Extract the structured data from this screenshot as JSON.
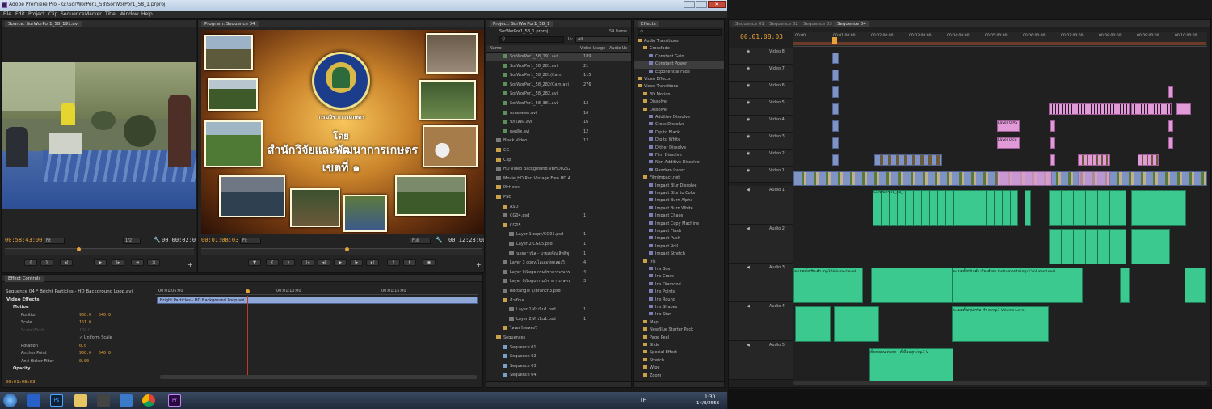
{
  "app": {
    "title": "Adobe Premiere Pro - G:\\SorWorPor1_58\\SorWorPor1_58_1.prproj",
    "menu": [
      "File",
      "Edit",
      "Project",
      "Clip",
      "Sequence",
      "Marker",
      "Title",
      "Window",
      "Help"
    ]
  },
  "source_monitor": {
    "tab": "Source: SorWorPor1_58_191.avi",
    "timecode_in": "00;58;43:00",
    "fit": "Fit",
    "timecode_out": "00:00:02:09",
    "zoom": "1/2"
  },
  "program_monitor": {
    "tab": "Program: Sequence 04",
    "timecode_in": "00:01:08:03",
    "fit": "Fit",
    "full": "Full",
    "timecode_out": "00:12:28:00",
    "title_line1": "โดย",
    "title_line2": "สำนักวิจัยและพัฒนาการเกษตร",
    "title_line3": "เขตที่ ๑",
    "logo_text": "กรมวิชาการเกษตร"
  },
  "effect_controls": {
    "tab": "Effect Controls",
    "clip_label": "Sequence 04 * Bright Particles - HD Background Loop.avi",
    "ruler": [
      "00:01:05:00",
      "00:01:10:00",
      "00:01:15:00"
    ],
    "timeline_clip": "Bright Particles - HD Background Loop.avi",
    "section": "Video Effects",
    "rows": [
      {
        "name": "Motion",
        "v1": "",
        "v2": ""
      },
      {
        "name": "Position",
        "v1": "960.0",
        "v2": "540.0"
      },
      {
        "name": "Scale",
        "v1": "151.0",
        "v2": ""
      },
      {
        "name": "Scale Width",
        "v1": "100.0",
        "v2": ""
      },
      {
        "name": "Uniform Scale",
        "v1": "",
        "v2": ""
      },
      {
        "name": "Rotation",
        "v1": "0.0",
        "v2": ""
      },
      {
        "name": "Anchor Point",
        "v1": "960.0",
        "v2": "540.0"
      },
      {
        "name": "Anti-flicker Filter",
        "v1": "0.00",
        "v2": ""
      },
      {
        "name": "Opacity",
        "v1": "",
        "v2": ""
      }
    ],
    "footer_tc": "00:01:08:03"
  },
  "project": {
    "tab": "Project: SorWorPor1_58_1",
    "file": "SorWorPor1_58_1.prproj",
    "items_count": "54 Items",
    "in_label": "In:",
    "in_value": "All",
    "col_name": "Name",
    "col_usage": "Video Usage",
    "col_audio": "Audio Us",
    "items": [
      {
        "name": "SorWorPor1_58_191.avi",
        "usage": "189",
        "type": "vid",
        "indent": 2
      },
      {
        "name": "SorWorPor1_58_281.avi",
        "usage": "21",
        "type": "vid",
        "indent": 2
      },
      {
        "name": "SorWorPor1_58_281(Cam)",
        "usage": "115",
        "type": "vid",
        "indent": 2
      },
      {
        "name": "SorWorPor1_58_282(Cam)avi",
        "usage": "276",
        "type": "vid",
        "indent": 2
      },
      {
        "name": "SorWorPor1_58_282.avi",
        "usage": "",
        "type": "vid",
        "indent": 2
      },
      {
        "name": "SorWorPor1_58_381.avi",
        "usage": "12",
        "type": "vid",
        "indent": 2
      },
      {
        "name": "ละออสดสด.avi",
        "usage": "16",
        "type": "vid",
        "indent": 2
      },
      {
        "name": "นักแสดง.avi",
        "usage": "16",
        "type": "vid",
        "indent": 2
      },
      {
        "name": "ผลผลิต.avi",
        "usage": "12",
        "type": "vid",
        "indent": 2
      },
      {
        "name": "Black Video",
        "usage": "12",
        "type": "file",
        "indent": 1
      },
      {
        "name": "CG",
        "usage": "",
        "type": "bin",
        "indent": 1
      },
      {
        "name": "Clip",
        "usage": "",
        "type": "bin",
        "indent": 1
      },
      {
        "name": "HD Video Background VBHD0262",
        "usage": "",
        "type": "file",
        "indent": 1
      },
      {
        "name": "Movie_HD Red Vintage Free HD 4",
        "usage": "",
        "type": "file",
        "indent": 1
      },
      {
        "name": "Pictures",
        "usage": "",
        "type": "bin",
        "indent": 1
      },
      {
        "name": "PSD",
        "usage": "",
        "type": "bin",
        "indent": 1
      },
      {
        "name": "ASD",
        "usage": "",
        "type": "bin",
        "indent": 2
      },
      {
        "name": "CG04.psd",
        "usage": "1",
        "type": "file",
        "indent": 2
      },
      {
        "name": "CG05",
        "usage": "",
        "type": "bin",
        "indent": 2
      },
      {
        "name": "Layer 1 copy/CG05.psd",
        "usage": "1",
        "type": "file",
        "indent": 3
      },
      {
        "name": "Layer 2/CG05.psd",
        "usage": "1",
        "type": "file",
        "indent": 3
      },
      {
        "name": "นายดาวนิล - นายเขจีญ สิทธิ์ชู",
        "usage": "1",
        "type": "file",
        "indent": 3
      },
      {
        "name": "Layer 3 copy/ไลเออร์ทดลองวิ",
        "usage": "4",
        "type": "file",
        "indent": 2
      },
      {
        "name": "Layer 0/Logo กรมวิชาการเกษตร",
        "usage": "4",
        "type": "file",
        "indent": 2
      },
      {
        "name": "Layer 0/Logo กรมวิชาการเกษตร",
        "usage": "3",
        "type": "file",
        "indent": 2
      },
      {
        "name": "Rectangle 1/Branch3.psd",
        "usage": "",
        "type": "file",
        "indent": 2
      },
      {
        "name": "ดำเนินจ",
        "usage": "",
        "type": "bin",
        "indent": 2
      },
      {
        "name": "Layer 1/ดำเนิน1.psd",
        "usage": "1",
        "type": "file",
        "indent": 3
      },
      {
        "name": "Layer 2/ดำเนิน1.psd",
        "usage": "1",
        "type": "file",
        "indent": 3
      },
      {
        "name": "ไลเออร์ทดลองวิ",
        "usage": "",
        "type": "bin",
        "indent": 2
      },
      {
        "name": "Sequences",
        "usage": "",
        "type": "bin",
        "indent": 1
      },
      {
        "name": "Sequence 01",
        "usage": "",
        "type": "seq",
        "indent": 2
      },
      {
        "name": "Sequence 02",
        "usage": "",
        "type": "seq",
        "indent": 2
      },
      {
        "name": "Sequence 03",
        "usage": "",
        "type": "seq",
        "indent": 2
      },
      {
        "name": "Sequence 04",
        "usage": "",
        "type": "seq",
        "indent": 2
      }
    ]
  },
  "effects": {
    "tab": "Effects",
    "items": [
      {
        "name": "Audio Transitions",
        "type": "bin",
        "indent": 0
      },
      {
        "name": "Crossfade",
        "type": "bin",
        "indent": 1
      },
      {
        "name": "Constant Gain",
        "type": "fx",
        "indent": 2
      },
      {
        "name": "Constant Power",
        "type": "fx",
        "indent": 2
      },
      {
        "name": "Exponential Fade",
        "type": "fx",
        "indent": 2
      },
      {
        "name": "Video Effects",
        "type": "bin",
        "indent": 0
      },
      {
        "name": "Video Transitions",
        "type": "bin",
        "indent": 0
      },
      {
        "name": "3D Motion",
        "type": "bin",
        "indent": 1
      },
      {
        "name": "Dissolve",
        "type": "bin",
        "indent": 1
      },
      {
        "name": "Dissolve",
        "type": "bin",
        "indent": 1
      },
      {
        "name": "Additive Dissolve",
        "type": "fx",
        "indent": 2
      },
      {
        "name": "Cross Dissolve",
        "type": "fx",
        "indent": 2
      },
      {
        "name": "Dip to Black",
        "type": "fx",
        "indent": 2
      },
      {
        "name": "Dip to White",
        "type": "fx",
        "indent": 2
      },
      {
        "name": "Dither Dissolve",
        "type": "fx",
        "indent": 2
      },
      {
        "name": "Film Dissolve",
        "type": "fx",
        "indent": 2
      },
      {
        "name": "Non-Additive Dissolve",
        "type": "fx",
        "indent": 2
      },
      {
        "name": "Random Invert",
        "type": "fx",
        "indent": 2
      },
      {
        "name": "FilmImpact.net",
        "type": "bin",
        "indent": 1
      },
      {
        "name": "Impact Blur Dissolve",
        "type": "fx",
        "indent": 2
      },
      {
        "name": "Impact Blur to Color",
        "type": "fx",
        "indent": 2
      },
      {
        "name": "Impact Burn Alpha",
        "type": "fx",
        "indent": 2
      },
      {
        "name": "Impact Burn White",
        "type": "fx",
        "indent": 2
      },
      {
        "name": "Impact Chaos",
        "type": "fx",
        "indent": 2
      },
      {
        "name": "Impact Copy Machine",
        "type": "fx",
        "indent": 2
      },
      {
        "name": "Impact Flash",
        "type": "fx",
        "indent": 2
      },
      {
        "name": "Impact Push",
        "type": "fx",
        "indent": 2
      },
      {
        "name": "Impact Roll",
        "type": "fx",
        "indent": 2
      },
      {
        "name": "Impact Stretch",
        "type": "fx",
        "indent": 2
      },
      {
        "name": "Iris",
        "type": "bin",
        "indent": 1
      },
      {
        "name": "Iris Box",
        "type": "fx",
        "indent": 2
      },
      {
        "name": "Iris Cross",
        "type": "fx",
        "indent": 2
      },
      {
        "name": "Iris Diamond",
        "type": "fx",
        "indent": 2
      },
      {
        "name": "Iris Points",
        "type": "fx",
        "indent": 2
      },
      {
        "name": "Iris Round",
        "type": "fx",
        "indent": 2
      },
      {
        "name": "Iris Shapes",
        "type": "fx",
        "indent": 2
      },
      {
        "name": "Iris Star",
        "type": "fx",
        "indent": 2
      },
      {
        "name": "Map",
        "type": "bin",
        "indent": 1
      },
      {
        "name": "NewBlue Starter Pack",
        "type": "bin",
        "indent": 1
      },
      {
        "name": "Page Peel",
        "type": "bin",
        "indent": 1
      },
      {
        "name": "Slide",
        "type": "bin",
        "indent": 1
      },
      {
        "name": "Special Effect",
        "type": "bin",
        "indent": 1
      },
      {
        "name": "Stretch",
        "type": "bin",
        "indent": 1
      },
      {
        "name": "Wipe",
        "type": "bin",
        "indent": 1
      },
      {
        "name": "Zoom",
        "type": "bin",
        "indent": 1
      }
    ]
  },
  "timeline": {
    "tabs": [
      "Sequence 01",
      "Sequence 02",
      "Sequence 03",
      "Sequence 04"
    ],
    "timecode": "00:01:08:03",
    "ruler": [
      "00:00",
      "00:01:00:00",
      "00:02:00:00",
      "00:03:00:00",
      "00:04:00:00",
      "00:05:00:00",
      "00:06:00:00",
      "00:07:00:00",
      "00:08:00:00",
      "00:09:00:00",
      "00:10:00:00",
      "00:11:00"
    ],
    "video_tracks": [
      "Video 8",
      "Video 7",
      "Video 6",
      "Video 5",
      "Video 4",
      "Video 3",
      "Video 2",
      "Video 1"
    ],
    "audio_tracks": [
      "Audio 1",
      "Audio 2",
      "Audio 3",
      "Audio 4",
      "Audio 5"
    ],
    "clip_labels": {
      "layer_a": "Layer 0/AS",
      "layer_b": "Layer 0 co",
      "a3_clip1": "ละเมดทั้งกรีม-คำ.mp3 Volume:Level",
      "a3_clip2": "ละเมดทั้งกรีม-คำ เรื่องคำลา Instrumental.mp3 Volume:Level",
      "a4_clip": "ละเมดทั้งสรุป กรีม-คำ-ถ.mp3 Volume:Level",
      "a5_clip": "ตั้งสายดน-ทยคค - ตั้งล็อลทุก.mp3 V",
      "a1_label": "SorWorPor1_58_"
    }
  },
  "taskbar": {
    "lang": "TH",
    "time": "1:30",
    "date": "14/8/2556"
  }
}
